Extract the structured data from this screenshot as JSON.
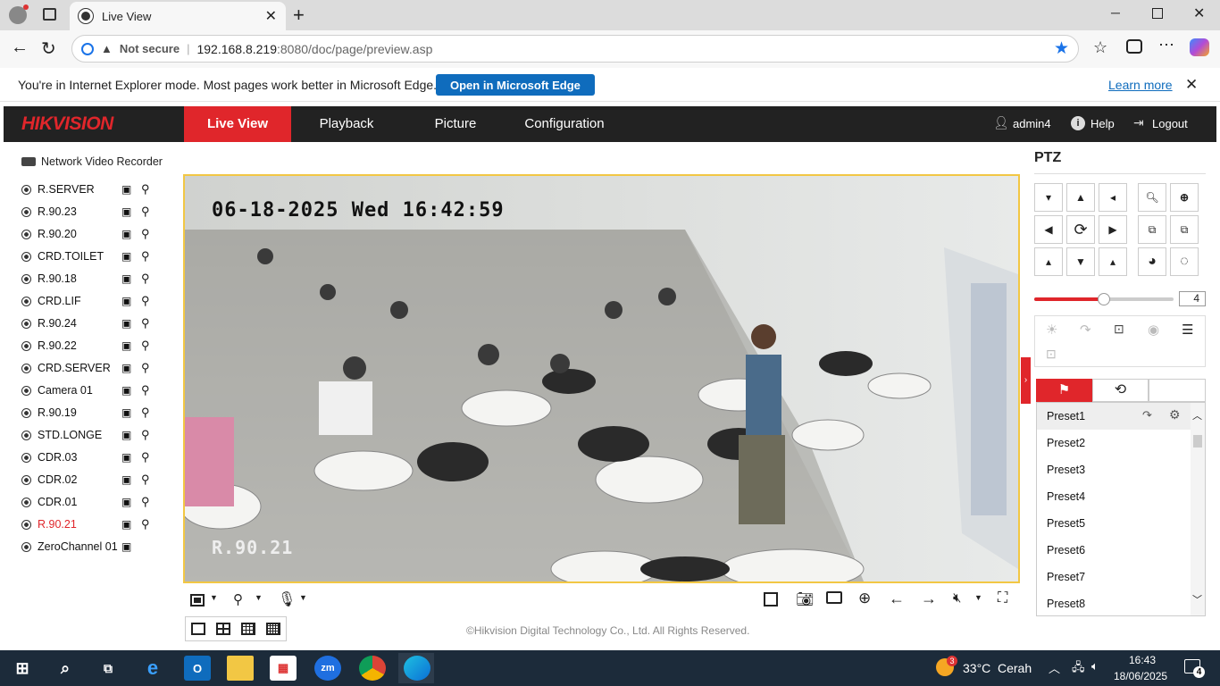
{
  "browser": {
    "tab_title": "Live View",
    "not_secure": "Not secure",
    "url_host": "192.168.8.219",
    "url_rest": ":8080/doc/page/preview.asp"
  },
  "ie_bar": {
    "message": "You're in Internet Explorer mode. Most pages work better in Microsoft Edge.",
    "open_button": "Open in Microsoft Edge",
    "learn_more": "Learn more"
  },
  "app": {
    "logo": "HIKVISION",
    "nav": [
      "Live View",
      "Playback",
      "Picture",
      "Configuration"
    ],
    "user": "admin4",
    "help": "Help",
    "logout": "Logout"
  },
  "device_title": "Network Video Recorder",
  "channels": [
    "R.SERVER",
    "R.90.23",
    "R.90.20",
    "CRD.TOILET",
    "R.90.18",
    "CRD.LIF",
    "R.90.24",
    "R.90.22",
    "CRD.SERVER",
    "Camera 01",
    "R.90.19",
    "STD.LONGE",
    "CDR.03",
    "CDR.02",
    "CDR.01",
    "R.90.21",
    "ZeroChannel 01"
  ],
  "active_channel": "R.90.21",
  "video": {
    "osd_datetime": "06-18-2025 Wed 16:42:59",
    "osd_name": "R.90.21"
  },
  "footer": "©Hikvision Digital Technology Co., Ltd. All Rights Reserved.",
  "ptz": {
    "title": "PTZ",
    "speed": "4",
    "speed_fraction": 0.5,
    "presets": [
      "Preset1",
      "Preset2",
      "Preset3",
      "Preset4",
      "Preset5",
      "Preset6",
      "Preset7",
      "Preset8"
    ]
  },
  "taskbar": {
    "weather_temp": "33°C",
    "weather_text": "Cerah",
    "weather_badge": "3",
    "time": "16:43",
    "date": "18/06/2025",
    "notif": "4",
    "zoom_label": "zm"
  }
}
